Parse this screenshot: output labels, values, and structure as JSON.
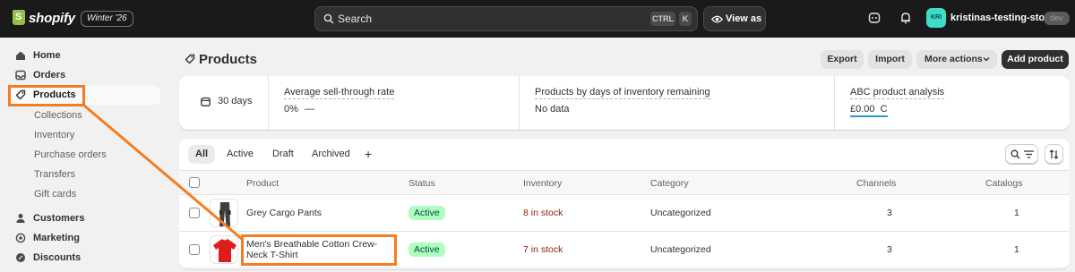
{
  "topbar": {
    "logo": "shopify",
    "edition": "Winter '26",
    "search_label": "Search",
    "shortcut_ctrl": "CTRL",
    "shortcut_k": "K",
    "view_as": "View as",
    "store_initials": "KRI",
    "store_name": "kristinas-testing-store",
    "store_badge": "dev"
  },
  "sidebar": {
    "home": "Home",
    "orders": "Orders",
    "products": "Products",
    "sub": [
      "Collections",
      "Inventory",
      "Purchase orders",
      "Transfers",
      "Gift cards"
    ],
    "customers": "Customers",
    "marketing": "Marketing",
    "discounts": "Discounts"
  },
  "page": {
    "title": "Products",
    "export": "Export",
    "import": "Import",
    "more_actions": "More actions",
    "add_product": "Add product"
  },
  "stats": {
    "date_range": "30 days",
    "sell_through_title": "Average sell-through rate",
    "sell_through_value": "0%",
    "sell_through_trend": "—",
    "inventory_days_title": "Products by days of inventory remaining",
    "inventory_days_value": "No data",
    "abc_title": "ABC product analysis",
    "abc_value": "£0.00",
    "abc_grade": "C"
  },
  "tabs": [
    "All",
    "Active",
    "Draft",
    "Archived"
  ],
  "tab_add": "+",
  "table": {
    "headers": {
      "product": "Product",
      "status": "Status",
      "inventory": "Inventory",
      "category": "Category",
      "channels": "Channels",
      "catalogs": "Catalogs"
    },
    "rows": [
      {
        "name": "Grey Cargo Pants",
        "status": "Active",
        "inventory": "8 in stock",
        "category": "Uncategorized",
        "channels": "3",
        "catalogs": "1"
      },
      {
        "name": "Men's Breathable Cotton Crew-Neck T-Shirt",
        "status": "Active",
        "inventory": "7 in stock",
        "category": "Uncategorized",
        "channels": "3",
        "catalogs": "1"
      }
    ]
  },
  "colors": {
    "accent_annotation": "#f57c1f",
    "active_badge_bg": "#affebf",
    "inventory_text": "#8e1f0b",
    "topbar_bg": "#1a1a1a"
  }
}
